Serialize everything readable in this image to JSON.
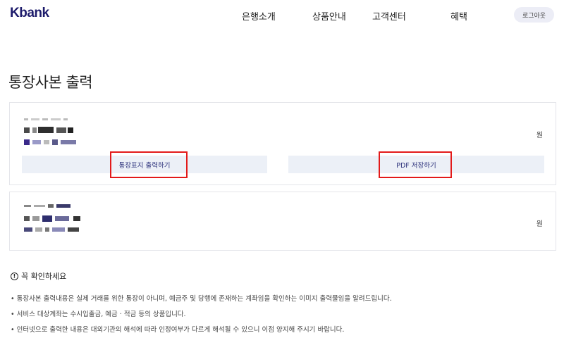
{
  "header": {
    "logo": "Kbank",
    "nav": [
      "은행소개",
      "상품안내",
      "고객센터",
      "혜택"
    ],
    "logout_label": "로그아웃"
  },
  "page": {
    "title": "통장사본 출력"
  },
  "accounts": [
    {
      "currency": "원",
      "print_cover_label": "통장표지 출력하기",
      "save_pdf_label": "PDF 저장하기"
    },
    {
      "currency": "원"
    }
  ],
  "notice": {
    "title": "꼭 확인하세요",
    "items": [
      "통장사본 출력내용은 실제 거래를 위한 통장이 아니며, 예금주 및 당행에 존재하는 계좌임을 확인하는 이미지 출력물임을 알려드립니다.",
      "서비스 대상계좌는 수시입출금, 예금 · 적금 등의 상품입니다.",
      "인터넷으로 출력한 내용은 대외기관의 해석에 따라 인정여부가 다르게 해석될 수 있으니 이점 양지해 주시기 바랍니다."
    ]
  },
  "colors": {
    "brand": "#1d1b6b",
    "button_bg": "#ecf0f7",
    "highlight": "#e31a1a"
  }
}
